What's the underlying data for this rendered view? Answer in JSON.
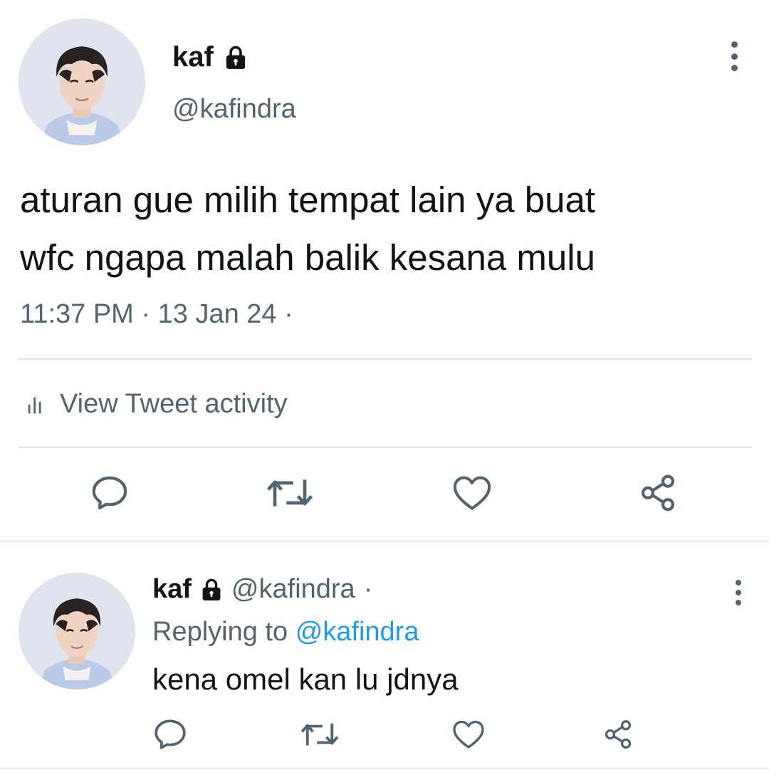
{
  "main_tweet": {
    "display_name": "kaf",
    "handle": "@kafindra",
    "text_lines": [
      "aturan gue milih tempat lain ya buat",
      "wfc ngapa malah balik kesana mulu"
    ],
    "time": "11:37 PM",
    "date": "13 Jan 24",
    "meta_sep": "·",
    "activity_label": "View Tweet activity",
    "icons": {
      "lock": "lock-icon",
      "more": "more-vertical-icon",
      "activity": "bar-chart-icon",
      "reply": "reply-icon",
      "retweet": "retweet-icon",
      "like": "heart-icon",
      "share": "share-icon"
    }
  },
  "reply_tweet": {
    "display_name": "kaf",
    "handle": "@kafindra",
    "separator": "·",
    "replying_prefix": "Replying to",
    "replying_to": "@kafindra",
    "text": "kena omel kan lu jdnya"
  },
  "colors": {
    "text": "#0f1419",
    "secondary": "#536471",
    "link": "#1d9bf0",
    "divider": "#dfe4e8"
  }
}
